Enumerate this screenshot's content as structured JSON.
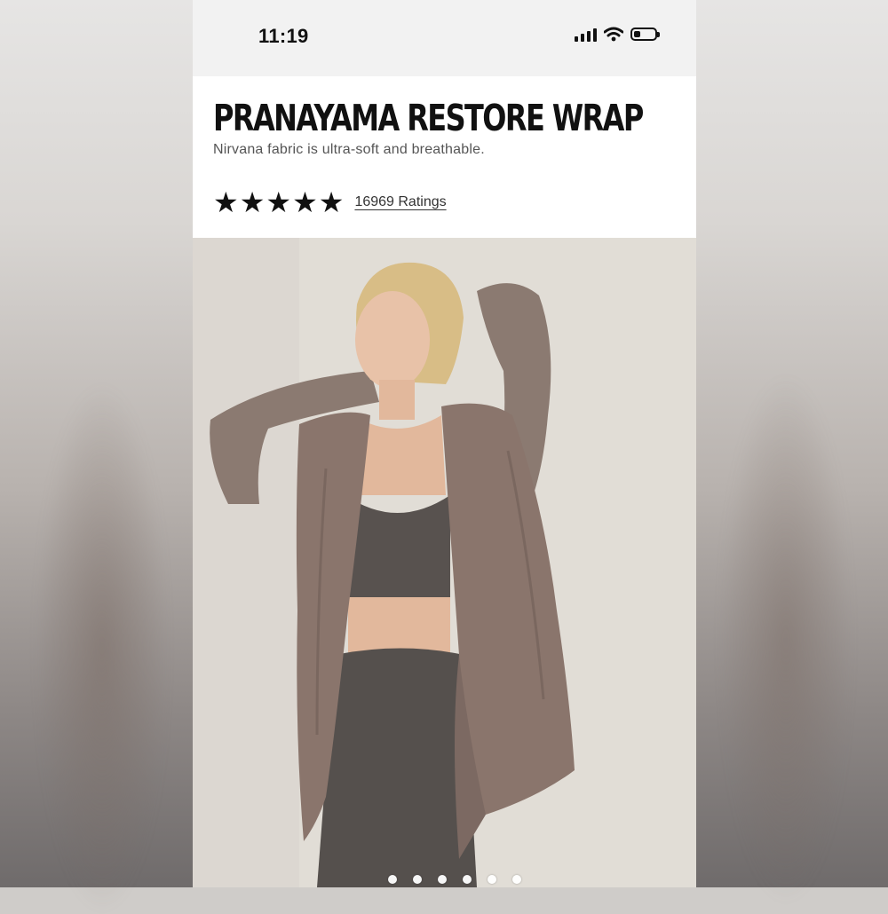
{
  "status_bar": {
    "time": "11:19",
    "signal_icon": "cellular-signal-icon",
    "wifi_icon": "wifi-icon",
    "battery_icon": "battery-icon",
    "battery_level": 0.3
  },
  "product": {
    "title": "PRANAYAMA RESTORE WRAP",
    "subtitle": "Nirvana fabric is ultra-soft and breathable.",
    "rating": {
      "stars": 5,
      "star_icon": "star-icon",
      "ratings_label": "16969 Ratings"
    }
  },
  "gallery": {
    "image_subject": "model-wearing-wrap-photo",
    "dot_count": 6,
    "active_index": 0
  },
  "colors": {
    "wrap": "#8a756c",
    "bra_leggings": "#55504d",
    "background": "#e0dcd5"
  }
}
